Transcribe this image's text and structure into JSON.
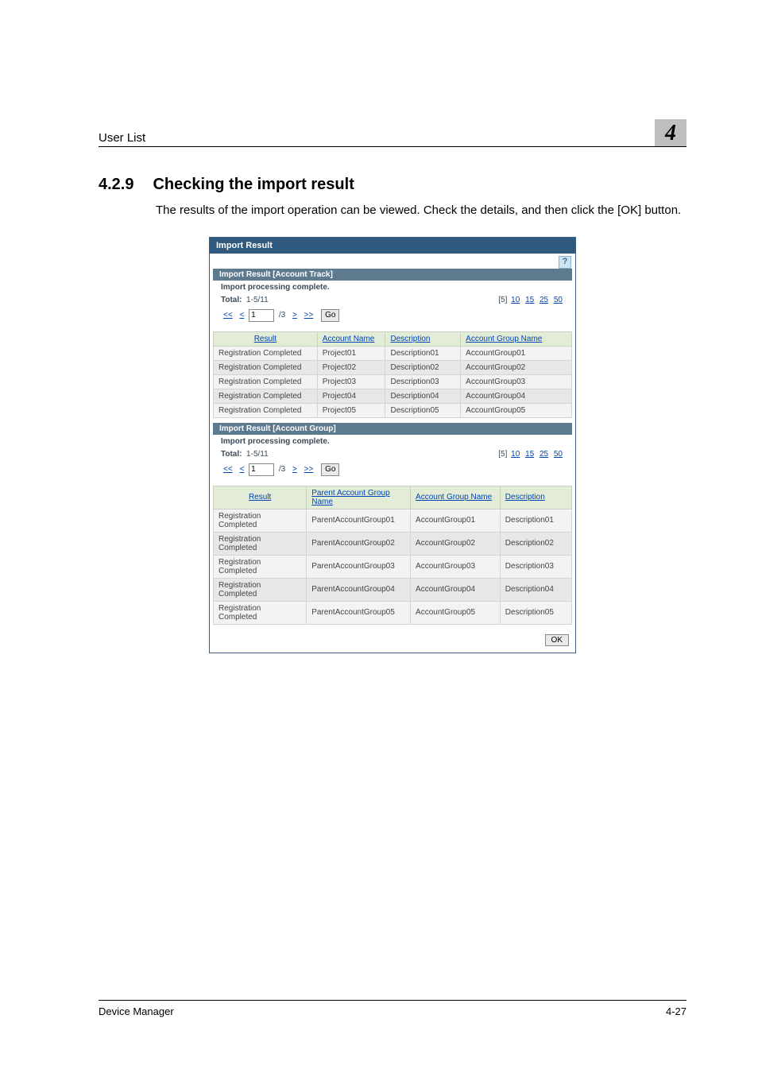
{
  "header": {
    "title": "User List",
    "chapter_number": "4"
  },
  "section": {
    "number": "4.2.9",
    "title": "Checking the import result",
    "body": "The results of the import operation can be viewed. Check the details, and then click the [OK] button."
  },
  "dialog": {
    "title": "Import Result",
    "help_glyph": "?",
    "track": {
      "section_title": "Import Result [Account Track]",
      "status": "Import processing complete.",
      "total_label": "Total:",
      "total_value": "1-5/11",
      "page_sizes": [
        "[5]",
        "10",
        "15",
        "25",
        "50"
      ],
      "pager": {
        "first": "<<",
        "prev": "<",
        "page_cur": "1",
        "page_total": "/3",
        "next": ">",
        "last": ">>",
        "go": "Go"
      },
      "cols": [
        "Result",
        "Account Name",
        "Description",
        "Account Group Name"
      ],
      "rows": [
        [
          "Registration Completed",
          "Project01",
          "Description01",
          "AccountGroup01"
        ],
        [
          "Registration Completed",
          "Project02",
          "Description02",
          "AccountGroup02"
        ],
        [
          "Registration Completed",
          "Project03",
          "Description03",
          "AccountGroup03"
        ],
        [
          "Registration Completed",
          "Project04",
          "Description04",
          "AccountGroup04"
        ],
        [
          "Registration Completed",
          "Project05",
          "Description05",
          "AccountGroup05"
        ]
      ]
    },
    "group": {
      "section_title": "Import Result [Account Group]",
      "status": "Import processing complete.",
      "total_label": "Total:",
      "total_value": "1-5/11",
      "page_sizes": [
        "[5]",
        "10",
        "15",
        "25",
        "50"
      ],
      "pager": {
        "first": "<<",
        "prev": "<",
        "page_cur": "1",
        "page_total": "/3",
        "next": ">",
        "last": ">>",
        "go": "Go"
      },
      "cols": [
        "Result",
        "Parent Account Group Name",
        "Account Group Name",
        "Description"
      ],
      "rows": [
        [
          "Registration Completed",
          "ParentAccountGroup01",
          "AccountGroup01",
          "Description01"
        ],
        [
          "Registration Completed",
          "ParentAccountGroup02",
          "AccountGroup02",
          "Description02"
        ],
        [
          "Registration Completed",
          "ParentAccountGroup03",
          "AccountGroup03",
          "Description03"
        ],
        [
          "Registration Completed",
          "ParentAccountGroup04",
          "AccountGroup04",
          "Description04"
        ],
        [
          "Registration Completed",
          "ParentAccountGroup05",
          "AccountGroup05",
          "Description05"
        ]
      ]
    },
    "ok_label": "OK"
  },
  "footer": {
    "left": "Device Manager",
    "right": "4-27"
  }
}
